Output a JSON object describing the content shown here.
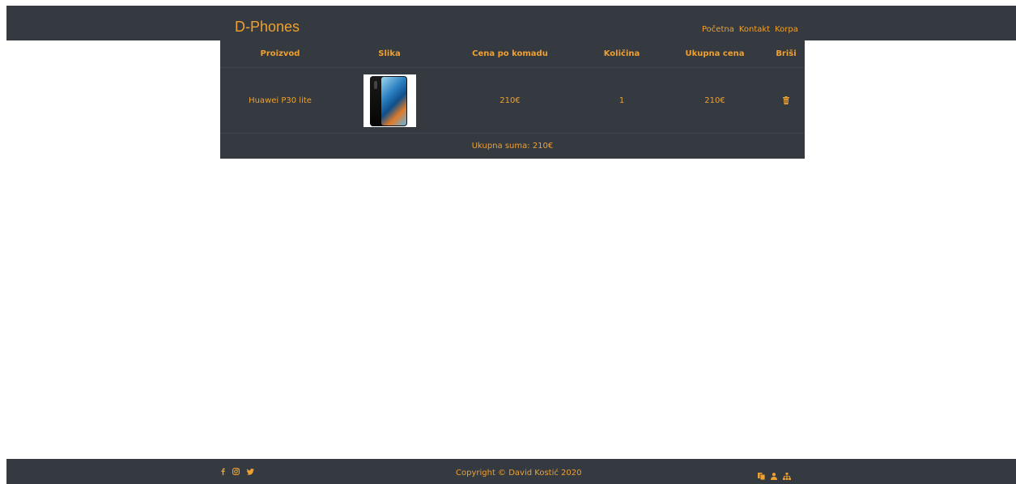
{
  "header": {
    "brand": "D-Phones",
    "nav": [
      "Početna",
      "Kontakt",
      "Korpa"
    ]
  },
  "cart": {
    "columns": [
      "Proizvod",
      "Slika",
      "Cena po komadu",
      "Količina",
      "Ukupna cena",
      "Briši"
    ],
    "rows": [
      {
        "product": "Huawei P30 lite",
        "image_icon": "phone-image",
        "unit_price": "210€",
        "quantity": "1",
        "total": "210€",
        "delete_icon": "trash-icon"
      }
    ],
    "summary": "Ukupna suma: 210€"
  },
  "footer": {
    "social_icons": [
      "facebook-icon",
      "instagram-icon",
      "twitter-icon"
    ],
    "copyright": "Copyright © David Kostić 2020",
    "right_icons": [
      "copy-icon",
      "user-icon",
      "sitemap-icon"
    ]
  },
  "colors": {
    "bar": "#343a40",
    "accent": "#f0a030"
  }
}
